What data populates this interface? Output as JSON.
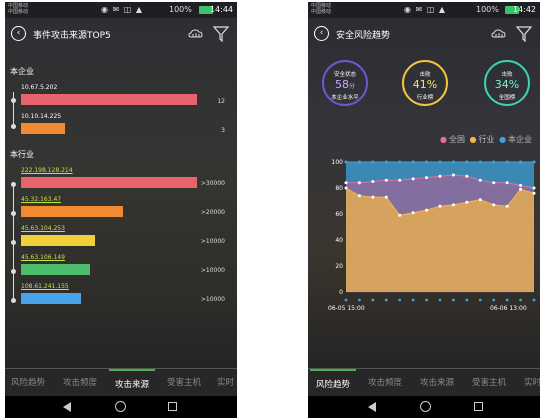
{
  "status_bar": {
    "carrier_1": "中国移动",
    "carrier_2": "中国移动",
    "battery_pct": "100%",
    "time_left": "14:44",
    "time_right": "14:42"
  },
  "left_screen": {
    "title": "事件攻击来源TOP5",
    "section_company": "本企业",
    "section_industry": "本行业",
    "company_items": [
      {
        "ip": "10.67.5.202",
        "value": "12",
        "color": "#e8636b",
        "fraction": 1.0
      },
      {
        "ip": "10.10.14.225",
        "value": "3",
        "color": "#f28a32",
        "fraction": 0.25
      }
    ],
    "industry_items": [
      {
        "ip": "222.198.128.214",
        "value": ">30000",
        "color": "#e8636b",
        "fraction": 1.0
      },
      {
        "ip": "45.32.163.47",
        "value": ">20000",
        "color": "#f28a32",
        "fraction": 0.58
      },
      {
        "ip": "45.63.104.253",
        "value": ">10000",
        "color": "#f2d03b",
        "fraction": 0.42
      },
      {
        "ip": "45.63.106.149",
        "value": ">10000",
        "color": "#4cbb6a",
        "fraction": 0.39
      },
      {
        "ip": "108.61.241.155",
        "value": ">10000",
        "color": "#4aa3e8",
        "fraction": 0.34
      }
    ],
    "tabs": [
      "风险趋势",
      "攻击频度",
      "攻击来源",
      "受害主机",
      "实时"
    ],
    "active_tab": 2
  },
  "right_screen": {
    "title": "安全风险趋势",
    "gauges": [
      {
        "top": "安全状态",
        "value": "58",
        "unit": "分",
        "bottom": "本企业水平",
        "ring_color": "#6a5acd",
        "value_color": "#c9a7ff"
      },
      {
        "top": "击败",
        "value": "41%",
        "unit": "",
        "bottom": "行业榜",
        "ring_color": "#f2c53b",
        "value_color": "#f6e56a"
      },
      {
        "top": "击败",
        "value": "34%",
        "unit": "",
        "bottom": "全国榜",
        "ring_color": "#3ed1b0",
        "value_color": "#7ef0d0"
      }
    ],
    "legend": [
      {
        "label": "全国",
        "color": "#e86ba6"
      },
      {
        "label": "行业",
        "color": "#f2b64a"
      },
      {
        "label": "本企业",
        "color": "#3da4e0"
      }
    ],
    "tabs": [
      "风险趋势",
      "攻击频度",
      "攻击来源",
      "受害主机",
      "实时"
    ],
    "active_tab": 0
  },
  "chart_data": {
    "type": "area",
    "x_start_label": "06-05 15:00",
    "x_end_label": "06-06 13:00",
    "ylim": [
      0,
      100
    ],
    "yticks": [
      "100",
      "80",
      "60",
      "40",
      "20",
      "0"
    ],
    "series": [
      {
        "name": "本企业",
        "color": "#3da4e0",
        "values": [
          100,
          100,
          100,
          100,
          100,
          100,
          100,
          100,
          100,
          100,
          100,
          100,
          100,
          100,
          100
        ]
      },
      {
        "name": "全国",
        "color": "#e86ba6",
        "values": [
          84,
          84,
          85,
          86,
          86,
          87,
          88,
          89,
          90,
          89,
          86,
          84,
          84,
          82,
          80
        ]
      },
      {
        "name": "行业",
        "color": "#f2b64a",
        "values": [
          80,
          74,
          73,
          73,
          59,
          61,
          63,
          66,
          67,
          69,
          71,
          67,
          66,
          79,
          76
        ]
      }
    ]
  }
}
